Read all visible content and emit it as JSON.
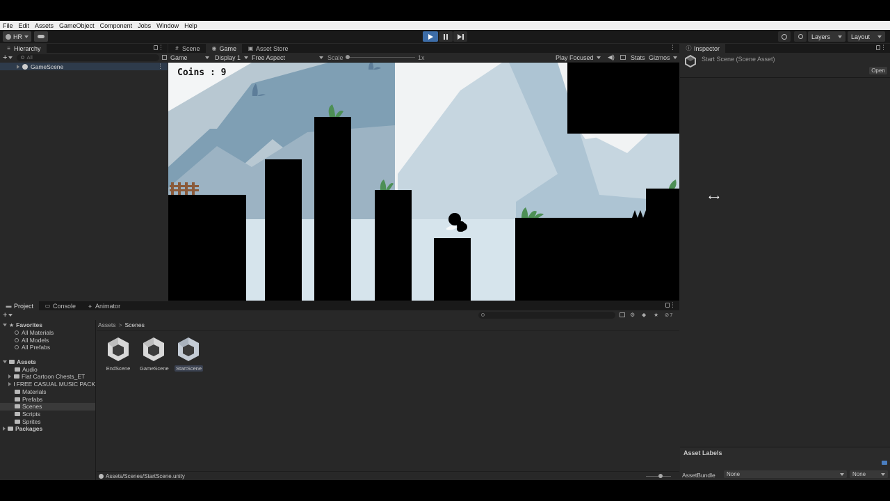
{
  "menubar": {
    "items": [
      "File",
      "Edit",
      "Assets",
      "GameObject",
      "Component",
      "Jobs",
      "Window",
      "Help"
    ]
  },
  "toolbar": {
    "account": "HR",
    "layers": "Layers",
    "layout": "Layout"
  },
  "hierarchy": {
    "tab": "Hierarchy",
    "search_placeholder": "All",
    "scene": "GameScene"
  },
  "scene_tabs": [
    "Scene",
    "Game",
    "Asset Store"
  ],
  "game_bar": {
    "mode": "Game",
    "display": "Display 1",
    "aspect": "Free Aspect",
    "scale_label": "Scale",
    "scale_value": "1x",
    "play_focused": "Play Focused",
    "stats": "Stats",
    "gizmos": "Gizmos"
  },
  "game_view": {
    "coins_text": "Coins : 9"
  },
  "inspector": {
    "tab": "Inspector",
    "title": "Start Scene (Scene Asset)",
    "open": "Open",
    "asset_labels": "Asset Labels",
    "asset_bundle_label": "AssetBundle",
    "asset_bundle_value": "None",
    "asset_variant_value": "None"
  },
  "project": {
    "tabs": [
      "Project",
      "Console",
      "Animator"
    ],
    "favorites_label": "Favorites",
    "favorites": [
      "All Materials",
      "All Models",
      "All Prefabs"
    ],
    "assets_label": "Assets",
    "folders": [
      "Audio",
      "Flat Cartoon Chests_ET",
      "FREE CASUAL MUSIC PACK",
      "Materials",
      "Prefabs",
      "Scenes",
      "Scripts",
      "Sprites"
    ],
    "packages_label": "Packages",
    "breadcrumb": [
      "Assets",
      "Scenes"
    ],
    "files": [
      "EndScene",
      "GameScene",
      "StartScene"
    ],
    "footer_path": "Assets/Scenes/StartScene.unity",
    "hidden_count": "7"
  }
}
